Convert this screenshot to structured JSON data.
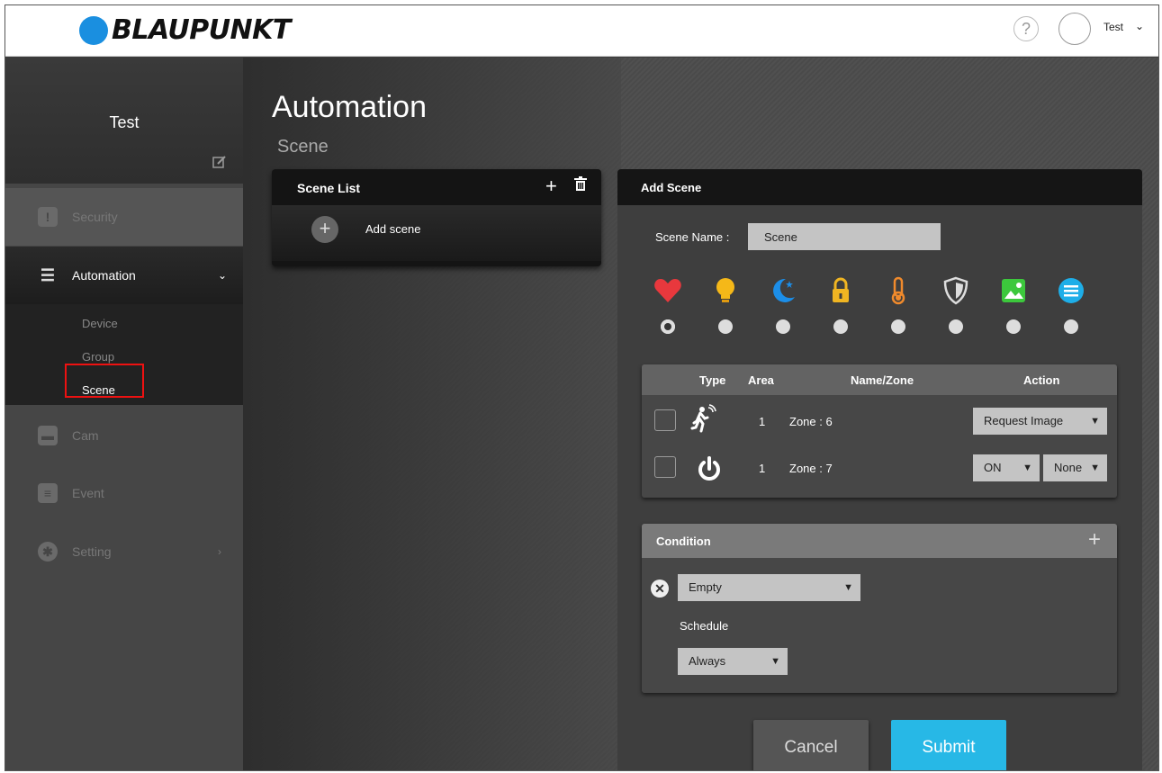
{
  "header": {
    "brand": "BLAUPUNKT",
    "help_label": "?",
    "user_name": "Test",
    "user_chevron": "⌄"
  },
  "sidebar": {
    "user_name": "Test",
    "items": [
      {
        "label": "Security",
        "icon": "shield-icon"
      },
      {
        "label": "Automation",
        "icon": "sliders-icon"
      },
      {
        "label": "Cam",
        "icon": "camera-icon"
      },
      {
        "label": "Event",
        "icon": "list-icon"
      },
      {
        "label": "Setting",
        "icon": "gear-icon"
      }
    ],
    "automation_sub": [
      "Device",
      "Group",
      "Scene"
    ],
    "chevron_down": "⌄",
    "chevron_right": "›"
  },
  "main": {
    "title": "Automation",
    "subtitle": "Scene"
  },
  "scene_list": {
    "title": "Scene List",
    "add_label": "Add scene"
  },
  "add_scene": {
    "title": "Add Scene",
    "name_label": "Scene Name :",
    "name_value": "Scene",
    "scene_icons": [
      "heart-icon",
      "bulb-icon",
      "moon-icon",
      "lock-icon",
      "thermometer-icon",
      "shield-icon",
      "picture-icon",
      "menu-icon"
    ],
    "selected_icon_index": 0,
    "table": {
      "headers": {
        "type": "Type",
        "area": "Area",
        "name_zone": "Name/Zone",
        "action": "Action"
      },
      "rows": [
        {
          "type_icon": "motion-icon",
          "area": "1",
          "zone": "Zone : 6",
          "action": "Request Image"
        },
        {
          "type_icon": "power-icon",
          "area": "1",
          "zone": "Zone : 7",
          "action": "ON",
          "action2": "None"
        }
      ]
    },
    "condition": {
      "title": "Condition",
      "value": "Empty",
      "schedule_label": "Schedule",
      "schedule_value": "Always"
    },
    "cancel_label": "Cancel",
    "submit_label": "Submit"
  },
  "colors": {
    "brand_blue": "#1a8fe0",
    "submit": "#27b8e6",
    "highlight_box": "#ee1111"
  }
}
